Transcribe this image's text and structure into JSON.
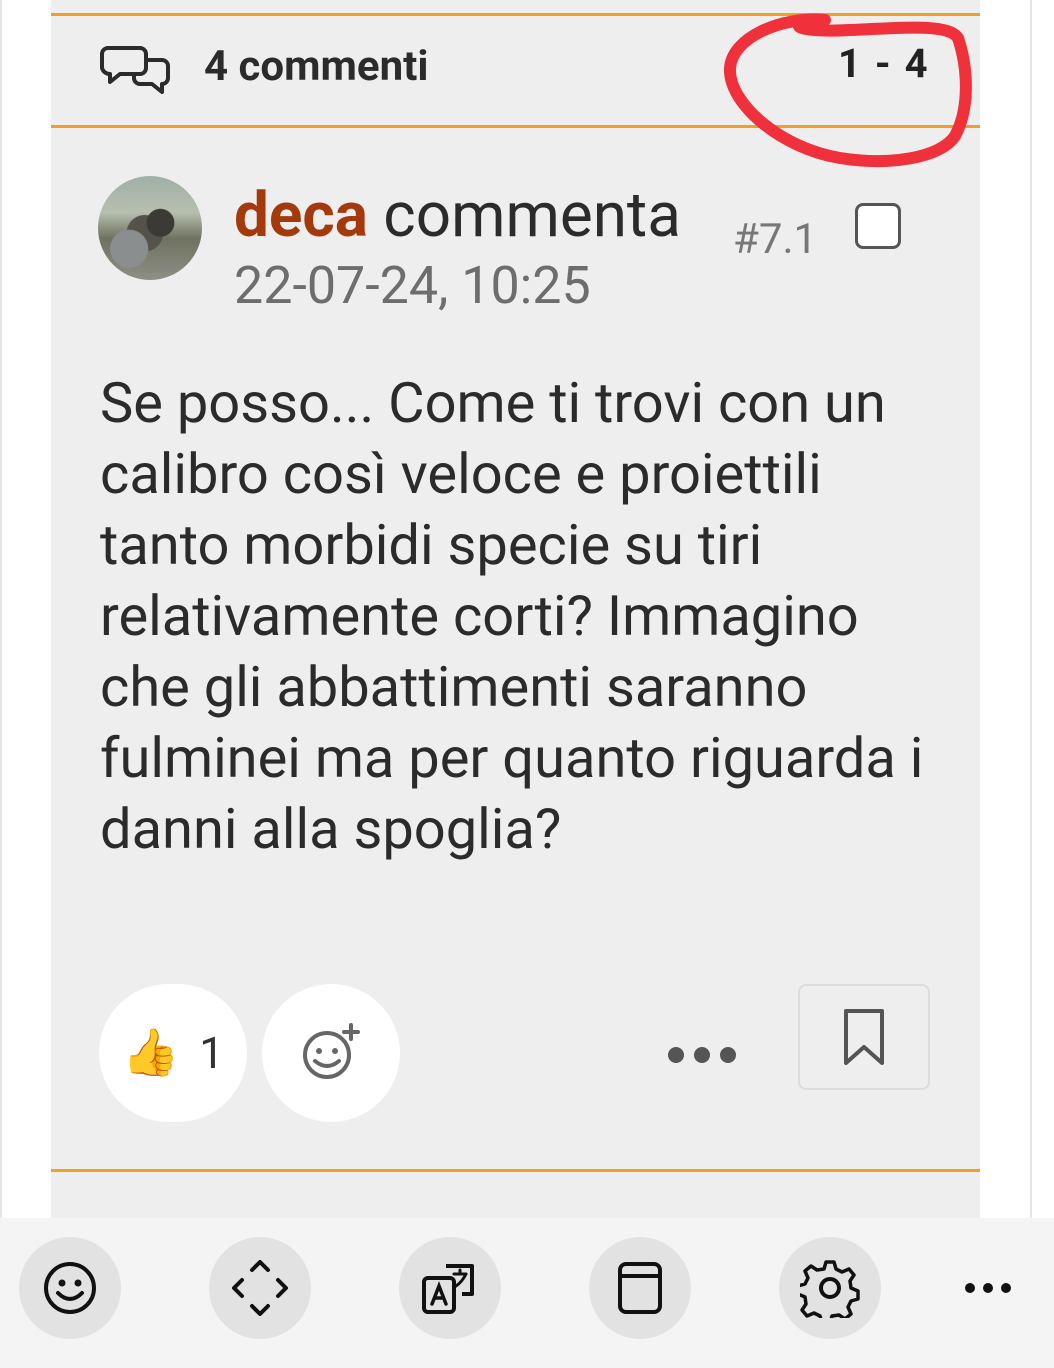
{
  "comments_header": {
    "title": "4 commenti",
    "range": "1 - 4",
    "icon": "chat-bubbles-icon"
  },
  "comment": {
    "author": "deca",
    "action": "commenta",
    "timestamp": "22-07-24, 10:25",
    "number": "#7.1",
    "body": "Se posso... Come ti trovi con un calibro così veloce e proiettili tanto morbidi specie su tiri relativamente corti? Immagino che gli abbattimenti saranno fulminei ma per quanto riguarda i danni alla spoglia?",
    "likes": "1",
    "like_emoji": "👍"
  },
  "colors": {
    "accent": "#f0a028",
    "author": "#a43a0c",
    "annotation": "#f0303a",
    "panel": "#eeeeee"
  },
  "toolbar": {
    "icons": [
      "emoji-icon",
      "expand-arrows-icon",
      "translate-icon",
      "clipboard-icon",
      "settings-gear-icon",
      "more-dots-icon"
    ]
  }
}
